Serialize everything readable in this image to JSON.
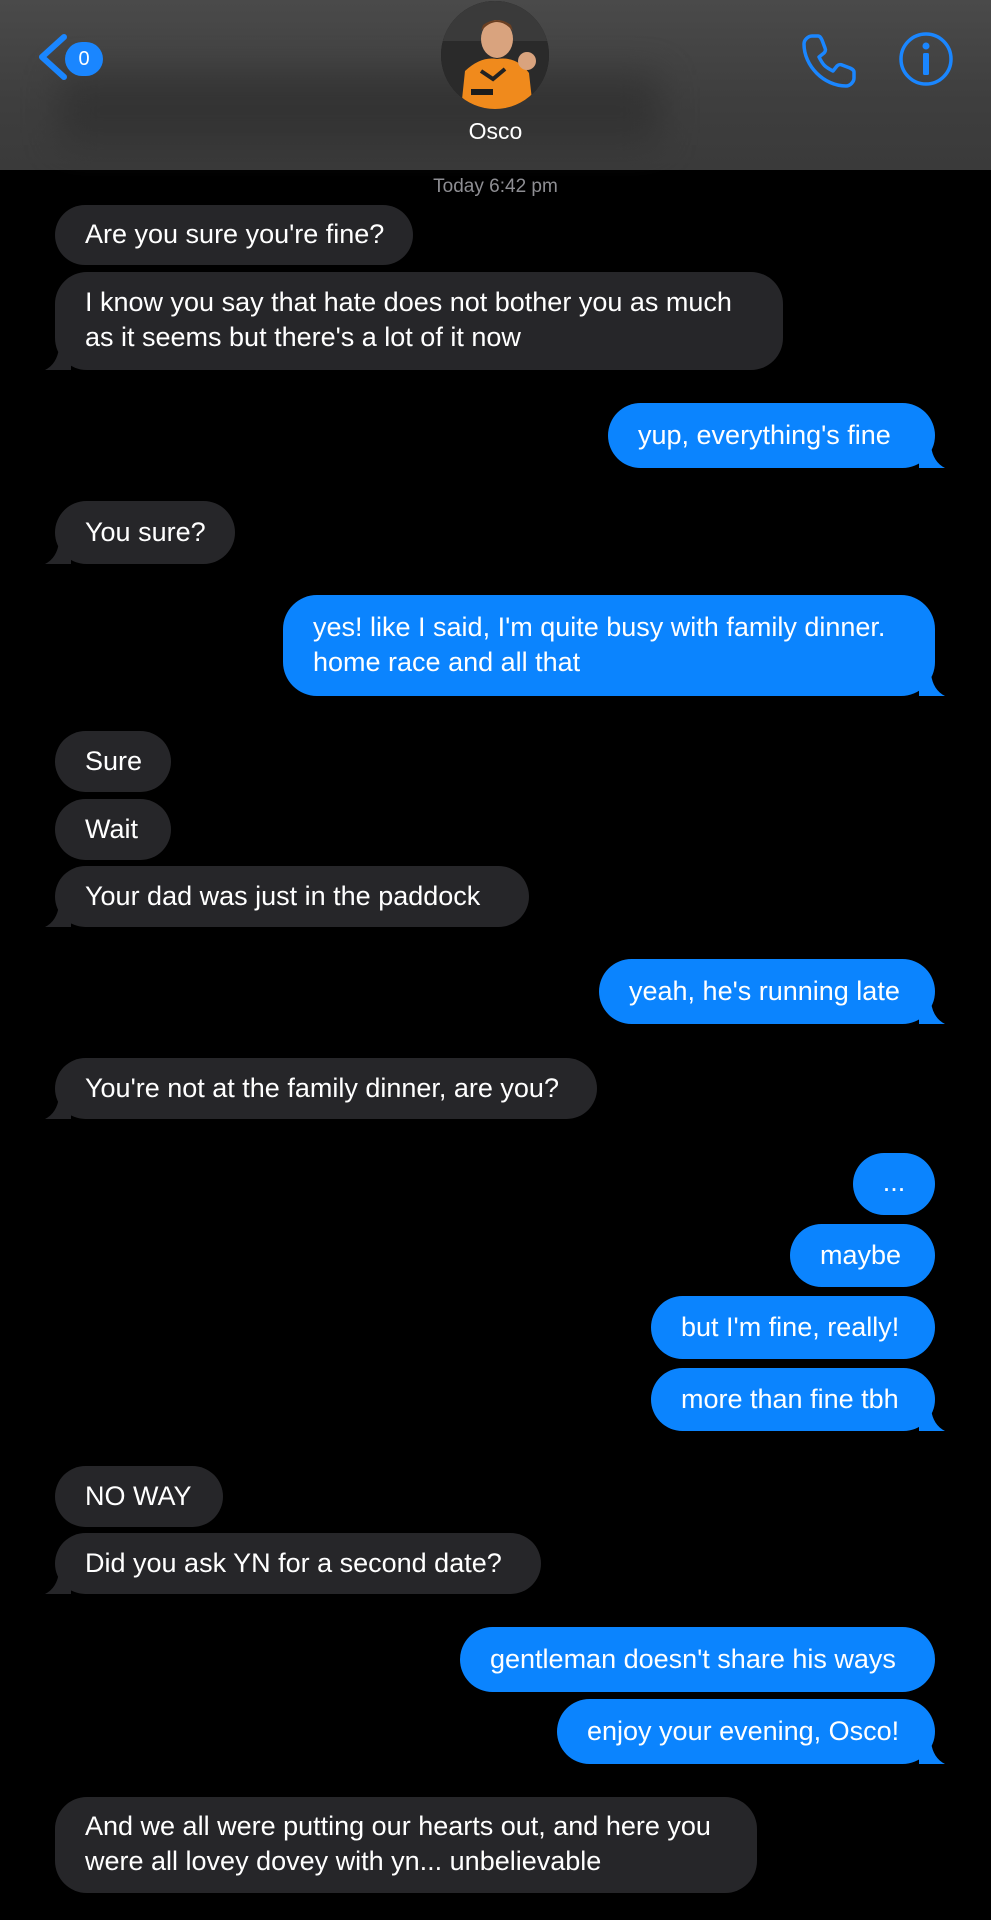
{
  "header": {
    "back_count": "0",
    "contact_name": "Osco",
    "accent_color": "#1a86ff"
  },
  "timestamp": "Today 6:42 pm",
  "messages": [
    {
      "dir": "received",
      "text": "Are you sure you're fine?"
    },
    {
      "dir": "received",
      "text": "I know you say that hate does not bother you as much as it seems but there's a lot of it now",
      "lines": [
        "I know you say that hate does not bother you as much",
        "as it seems but there's a lot of it now"
      ]
    },
    {
      "dir": "sent",
      "text": "yup, everything's fine"
    },
    {
      "dir": "received",
      "text": "You sure?"
    },
    {
      "dir": "sent",
      "text": "yes! like I said, I'm quite busy with family dinner. home race and all that",
      "lines": [
        "yes! like I said, I'm quite busy with family dinner.",
        "home race and all that"
      ]
    },
    {
      "dir": "received",
      "text": "Sure"
    },
    {
      "dir": "received",
      "text": "Wait"
    },
    {
      "dir": "received",
      "text": "Your dad was just in the paddock"
    },
    {
      "dir": "sent",
      "text": "yeah, he's running late"
    },
    {
      "dir": "received",
      "text": "You're not at the family dinner, are you?"
    },
    {
      "dir": "sent",
      "text": "..."
    },
    {
      "dir": "sent",
      "text": "maybe"
    },
    {
      "dir": "sent",
      "text": "but I'm fine, really!"
    },
    {
      "dir": "sent",
      "text": "more than fine tbh"
    },
    {
      "dir": "received",
      "text": "NO WAY"
    },
    {
      "dir": "received",
      "text": "Did you ask YN for a second date?"
    },
    {
      "dir": "sent",
      "text": "gentleman doesn't share his ways"
    },
    {
      "dir": "sent",
      "text": "enjoy your evening, Osco!"
    },
    {
      "dir": "received",
      "text": "And we all were putting our hearts out, and here you were all lovey dovey with yn... unbelievable",
      "lines": [
        "And we all were putting our hearts out, and here you",
        "were all lovey dovey with yn... unbelievable"
      ]
    }
  ],
  "colors": {
    "received_bubble": "#262629",
    "sent_bubble": "#0b84fe",
    "background": "#000000"
  },
  "icons": {
    "back": "chevron-left-icon",
    "call": "phone-icon",
    "info": "info-icon"
  }
}
